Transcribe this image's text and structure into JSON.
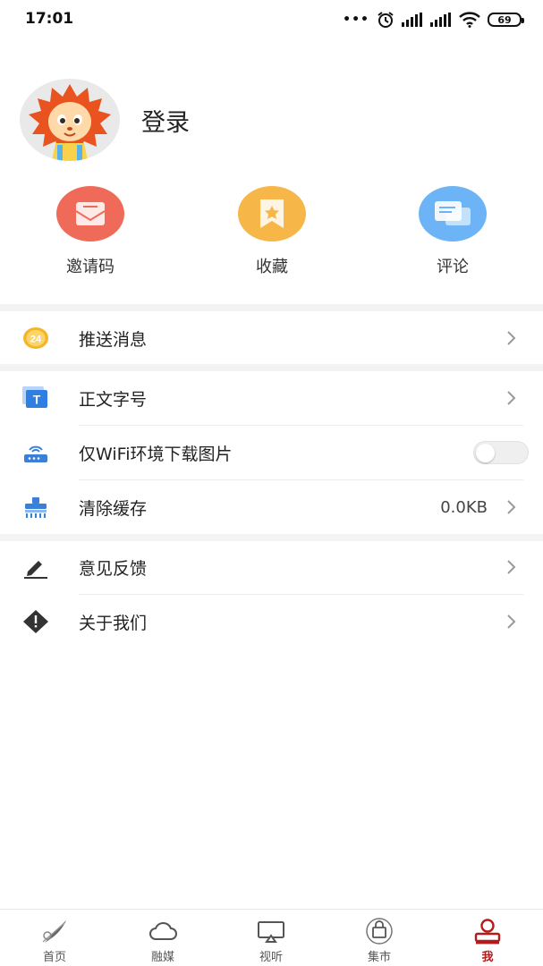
{
  "status_bar": {
    "time": "17:01",
    "dots": "•••",
    "battery": "69"
  },
  "profile": {
    "login_label": "登录"
  },
  "quick_actions": [
    {
      "label": "邀请码",
      "icon": "envelope-icon",
      "color": "#f06a5a"
    },
    {
      "label": "收藏",
      "icon": "bookmark-icon",
      "color": "#f7b648"
    },
    {
      "label": "评论",
      "icon": "chat-icon",
      "color": "#6cb4f5"
    }
  ],
  "menu": {
    "push": {
      "label": "推送消息",
      "icon": "badge-24-icon",
      "icon_text": "24"
    },
    "font_size": {
      "label": "正文字号",
      "icon": "text-t-icon",
      "icon_text": "T"
    },
    "wifi_only": {
      "label": "仅WiFi环境下载图片",
      "icon": "router-icon",
      "enabled": false
    },
    "clear_cache": {
      "label": "清除缓存",
      "icon": "broom-icon",
      "value": "0.0KB"
    },
    "feedback": {
      "label": "意见反馈",
      "icon": "pencil-icon"
    },
    "about": {
      "label": "关于我们",
      "icon": "warning-diamond-icon"
    }
  },
  "bottom_nav": [
    {
      "label": "首页",
      "icon": "home-feather-icon"
    },
    {
      "label": "融媒",
      "icon": "cloud-icon"
    },
    {
      "label": "视听",
      "icon": "screen-cast-icon"
    },
    {
      "label": "集市",
      "icon": "shopping-bag-icon"
    },
    {
      "label": "我",
      "icon": "user-icon",
      "active": true
    }
  ],
  "colors": {
    "accent": "#b21c1c",
    "separator": "#f3f3f3"
  }
}
